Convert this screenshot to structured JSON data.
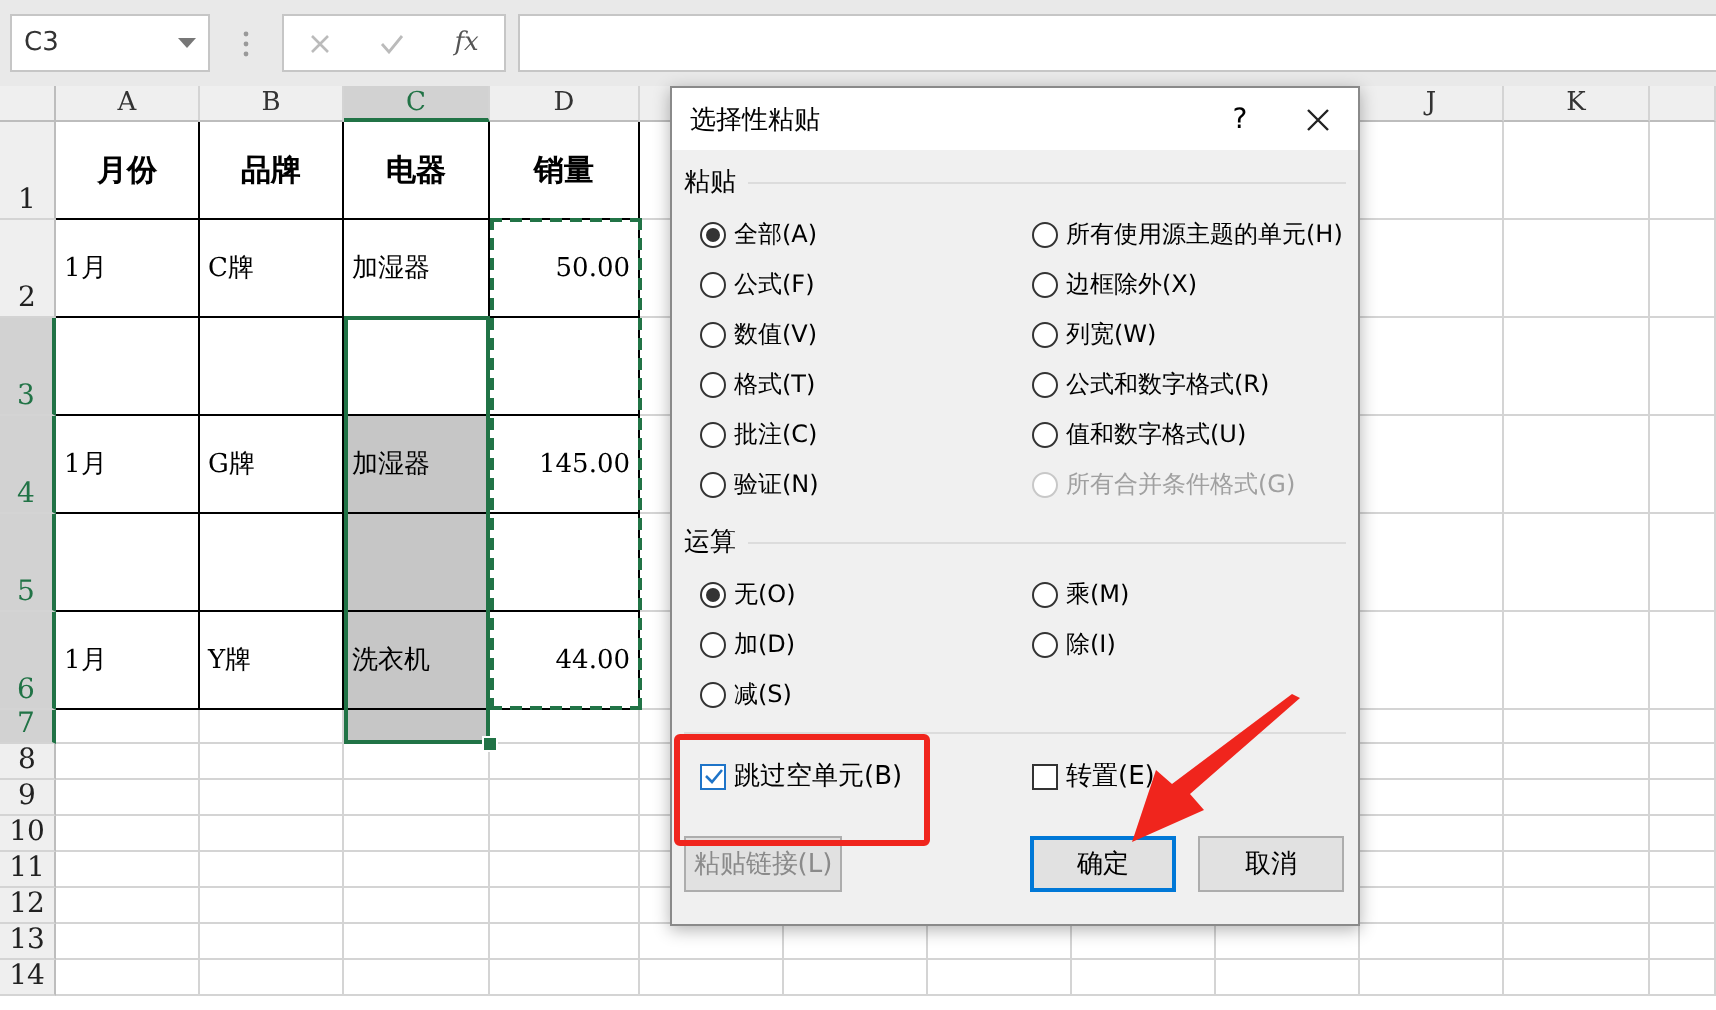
{
  "formula_bar": {
    "name_box": "C3",
    "fx": "fx"
  },
  "sheet": {
    "columns": [
      {
        "label": "A",
        "selected": false
      },
      {
        "label": "B",
        "selected": false
      },
      {
        "label": "C",
        "selected": true
      },
      {
        "label": "D",
        "selected": false
      },
      {
        "label": "J",
        "selected": false
      },
      {
        "label": "K",
        "selected": false
      }
    ],
    "rows": [
      {
        "number": "1",
        "selected": false,
        "cells": [
          {
            "text": "月份",
            "kind": "header",
            "selected": false
          },
          {
            "text": "品牌",
            "kind": "header",
            "selected": false
          },
          {
            "text": "电器",
            "kind": "header",
            "selected": false
          },
          {
            "text": "销量",
            "kind": "header",
            "selected": false
          }
        ]
      },
      {
        "number": "2",
        "selected": false,
        "cells": [
          {
            "text": "1月",
            "kind": "text",
            "selected": false
          },
          {
            "text": "C牌",
            "kind": "text",
            "selected": false
          },
          {
            "text": "加湿器",
            "kind": "text",
            "selected": false
          },
          {
            "text": "50.00",
            "kind": "number",
            "selected": false
          }
        ]
      },
      {
        "number": "3",
        "selected": true,
        "cells": [
          {
            "selected": false
          },
          {
            "selected": false
          },
          {
            "selected": false
          },
          {
            "selected": false
          }
        ]
      },
      {
        "number": "4",
        "selected": true,
        "cells": [
          {
            "text": "1月",
            "kind": "text",
            "selected": false
          },
          {
            "text": "G牌",
            "kind": "text",
            "selected": false
          },
          {
            "text": "加湿器",
            "kind": "text",
            "selected": true
          },
          {
            "text": "145.00",
            "kind": "number",
            "selected": false
          }
        ]
      },
      {
        "number": "5",
        "selected": true,
        "cells": [
          {
            "selected": false
          },
          {
            "selected": false
          },
          {
            "selected": true
          },
          {
            "selected": false
          }
        ]
      },
      {
        "number": "6",
        "selected": true,
        "cells": [
          {
            "text": "1月",
            "kind": "text",
            "selected": false
          },
          {
            "text": "Y牌",
            "kind": "text",
            "selected": false
          },
          {
            "text": "洗衣机",
            "kind": "text",
            "selected": true
          },
          {
            "text": "44.00",
            "kind": "number",
            "selected": false
          }
        ]
      },
      {
        "number": "7",
        "selected": true,
        "cells": [
          {
            "selected": false
          },
          {
            "selected": false
          },
          {
            "selected": true
          },
          {
            "selected": false
          }
        ]
      },
      {
        "number": "8",
        "selected": false
      },
      {
        "number": "9",
        "selected": false
      },
      {
        "number": "10",
        "selected": false
      },
      {
        "number": "11",
        "selected": false
      },
      {
        "number": "12",
        "selected": false
      },
      {
        "number": "13",
        "selected": false
      },
      {
        "number": "14",
        "selected": false
      }
    ]
  },
  "dialog": {
    "title": "选择性粘贴",
    "help": "?",
    "sections": [
      {
        "title": "粘贴",
        "options": [
          {
            "label": "全部(A)",
            "selected": true,
            "disabled": false
          },
          {
            "label": "所有使用源主题的单元(H)",
            "selected": false,
            "disabled": false
          },
          {
            "label": "公式(F)",
            "selected": false,
            "disabled": false
          },
          {
            "label": "边框除外(X)",
            "selected": false,
            "disabled": false
          },
          {
            "label": "数值(V)",
            "selected": false,
            "disabled": false
          },
          {
            "label": "列宽(W)",
            "selected": false,
            "disabled": false
          },
          {
            "label": "格式(T)",
            "selected": false,
            "disabled": false
          },
          {
            "label": "公式和数字格式(R)",
            "selected": false,
            "disabled": false
          },
          {
            "label": "批注(C)",
            "selected": false,
            "disabled": false
          },
          {
            "label": "值和数字格式(U)",
            "selected": false,
            "disabled": false
          },
          {
            "label": "验证(N)",
            "selected": false,
            "disabled": false
          },
          {
            "label": "所有合并条件格式(G)",
            "selected": false,
            "disabled": true
          }
        ]
      },
      {
        "title": "运算",
        "options": [
          {
            "label": "无(O)",
            "selected": true,
            "disabled": false
          },
          {
            "label": "乘(M)",
            "selected": false,
            "disabled": false
          },
          {
            "label": "加(D)",
            "selected": false,
            "disabled": false
          },
          {
            "label": "除(I)",
            "selected": false,
            "disabled": false
          },
          {
            "label": "减(S)",
            "selected": false,
            "disabled": false
          }
        ]
      }
    ],
    "checkboxes": [
      {
        "label": "跳过空单元(B)",
        "checked": true
      },
      {
        "label": "转置(E)",
        "checked": false
      }
    ],
    "buttons": [
      {
        "label": "粘贴链接(L)",
        "disabled": true,
        "default": false
      },
      {
        "label": "确定",
        "disabled": false,
        "default": true
      },
      {
        "label": "取消",
        "disabled": false,
        "default": false
      }
    ]
  }
}
